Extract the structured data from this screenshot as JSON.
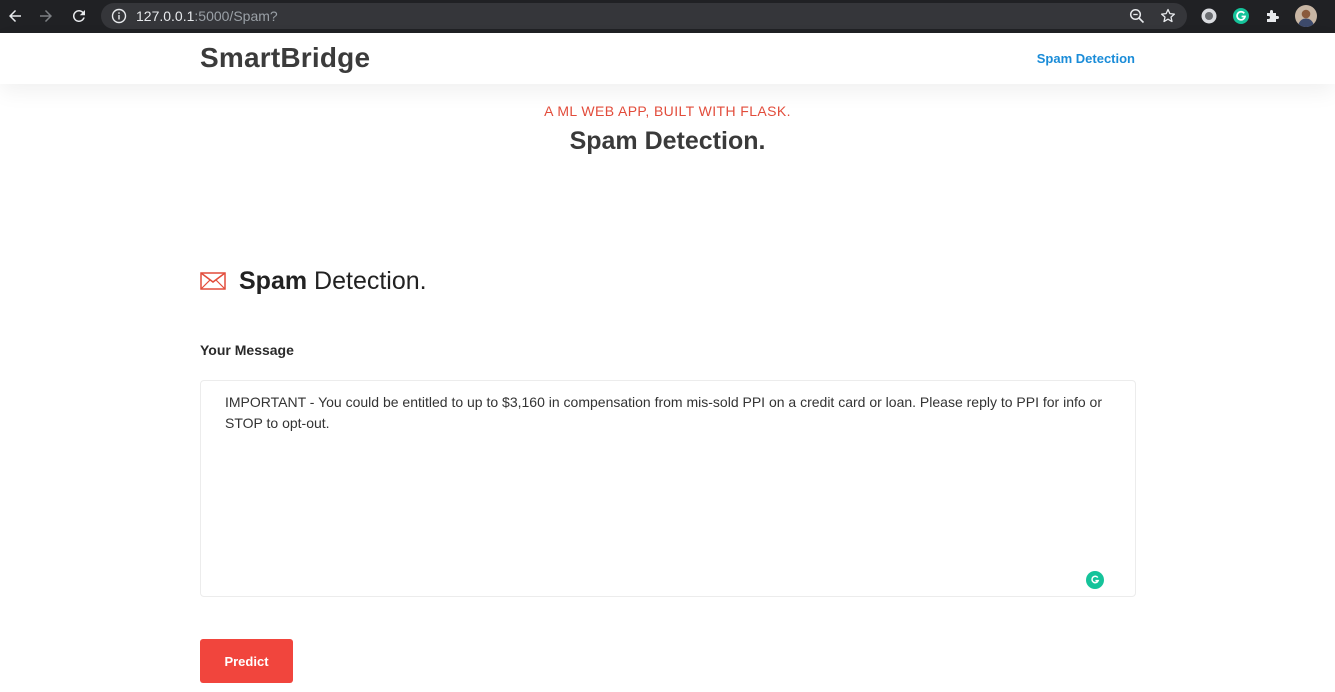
{
  "browser": {
    "url_host": "127.0.0.1",
    "url_rest": ":5000/Spam?",
    "icons": [
      "back-icon",
      "forward-icon",
      "reload-icon",
      "info-icon",
      "zoom-icon",
      "star-icon",
      "extension-record-icon",
      "grammarly-icon",
      "puzzle-icon",
      "profile-avatar"
    ]
  },
  "header": {
    "brand": "SmartBridge",
    "nav_link": "Spam Detection"
  },
  "hero": {
    "kicker": "A ML WEB APP, BUILT WITH FLASK.",
    "title": "Spam Detection."
  },
  "section": {
    "title_bold": "Spam",
    "title_rest": " Detection.",
    "icon": "envelope-icon"
  },
  "form": {
    "label": "Your Message",
    "message_value": "IMPORTANT - You could be entitled to up to $3,160 in compensation from mis-sold PPI on a credit card or loan. Please reply to PPI for info or STOP to opt-out.",
    "submit_label": "Predict"
  },
  "colors": {
    "accent_red": "#f1453d",
    "link_blue": "#1a8cd8",
    "grammarly_green": "#15c39a"
  }
}
